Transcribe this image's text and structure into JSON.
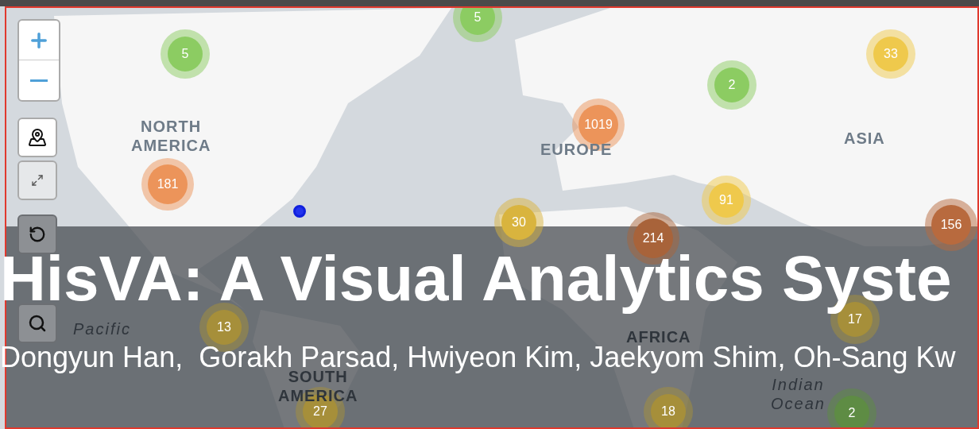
{
  "map": {
    "region_labels": [
      {
        "text": "NORTH\nAMERICA",
        "kind": "continent"
      },
      {
        "text": "EUROPE",
        "kind": "continent"
      },
      {
        "text": "ASIA",
        "kind": "continent"
      },
      {
        "text": "AFRICA",
        "kind": "continent"
      },
      {
        "text": "SOUTH\nAMERICA",
        "kind": "continent"
      },
      {
        "text": "Pacific",
        "kind": "ocean"
      },
      {
        "text": "Indian\nOcean",
        "kind": "ocean"
      }
    ],
    "clusters": [
      {
        "count": "5",
        "color": "#8ccc62"
      },
      {
        "count": "5",
        "color": "#8ccc62"
      },
      {
        "count": "2",
        "color": "#8ccc62"
      },
      {
        "count": "33",
        "color": "#efc94c"
      },
      {
        "count": "1019",
        "color": "#ec945a"
      },
      {
        "count": "181",
        "color": "#ec945a"
      },
      {
        "count": "91",
        "color": "#efc94c"
      },
      {
        "count": "30",
        "color": "#d9b43e"
      },
      {
        "count": "156",
        "color": "#b86a3e"
      },
      {
        "count": "214",
        "color": "#a8633a"
      },
      {
        "count": "13",
        "color": "#a68f3a"
      },
      {
        "count": "17",
        "color": "#a68f3a"
      },
      {
        "count": "27",
        "color": "#a68f3a"
      },
      {
        "count": "18",
        "color": "#a68f3a"
      },
      {
        "count": "2",
        "color": "#5e8c44"
      }
    ]
  },
  "overlay": {
    "title": "HisVA: A Visual Analytics Syste",
    "authors": "Dongyun Han,  Gorakh Parsad, Hwiyeon Kim, Jaekyom Shim, Oh-Sang Kw"
  }
}
